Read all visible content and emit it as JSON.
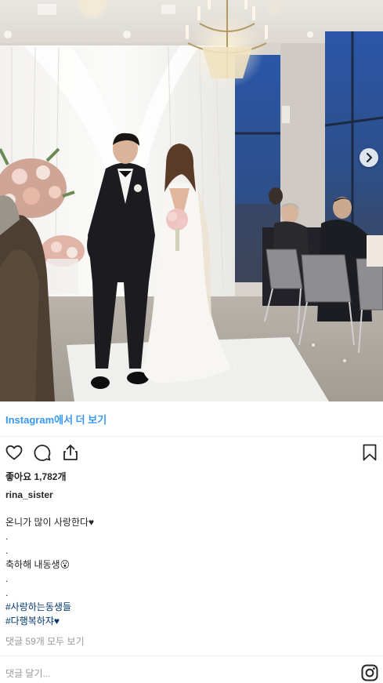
{
  "post": {
    "view_more": "Instagram에서 더 보기",
    "likes": "좋아요 1,782개",
    "username": "rina_sister",
    "caption_lines": [
      {
        "text": "온니가 많이 사랑한다♥",
        "hashtag": false
      },
      {
        "text": ".",
        "hashtag": false
      },
      {
        "text": ".",
        "hashtag": false
      },
      {
        "text": "축하해 내동생😮",
        "hashtag": false
      },
      {
        "text": ".",
        "hashtag": false
      },
      {
        "text": ".",
        "hashtag": false
      },
      {
        "text": "#사랑하는동생들",
        "hashtag": true
      },
      {
        "text": "#다행복하쟈♥",
        "hashtag": true
      }
    ],
    "comments_link": "댓글 59개 모두 보기",
    "comment_placeholder": "댓글 달기..."
  },
  "icons": {
    "like": "heart-icon",
    "comment": "comment-icon",
    "share": "share-icon",
    "bookmark": "bookmark-icon",
    "next": "chevron-right-icon",
    "logo": "instagram-icon"
  },
  "colors": {
    "link": "#3897f0",
    "hashtag": "#003569",
    "muted": "#999999",
    "text": "#262626"
  }
}
